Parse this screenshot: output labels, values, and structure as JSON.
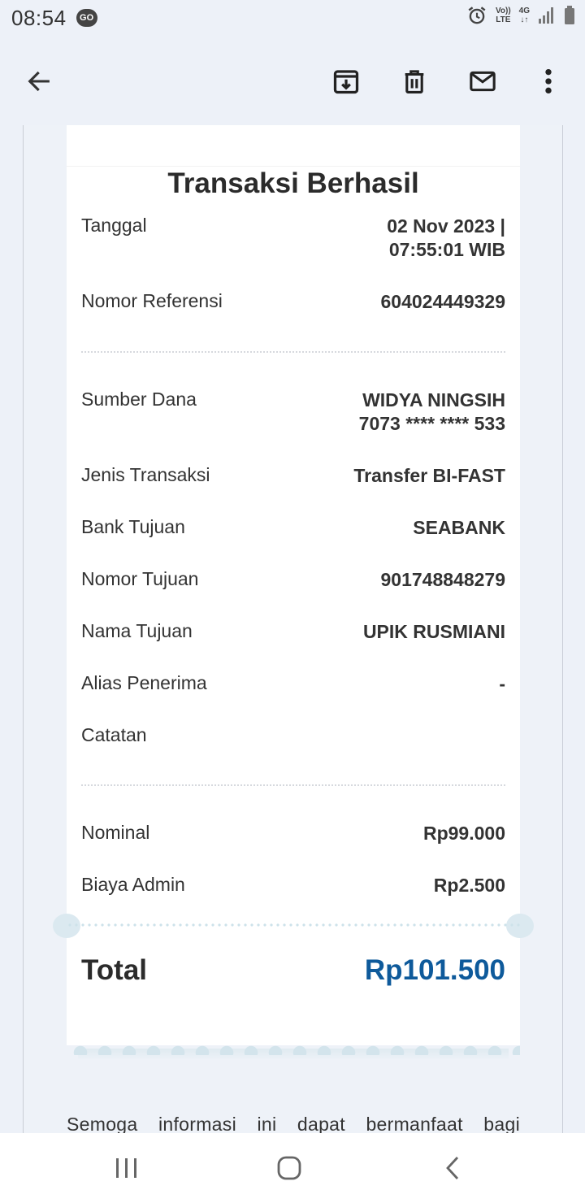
{
  "status_bar": {
    "time": "08:54",
    "app_badge": "GO",
    "volte_top": "Vo))",
    "volte_bottom": "LTE",
    "network_top": "4G",
    "network_bottom": "↓↑"
  },
  "app_bar": {
    "icons": [
      "back-arrow-icon",
      "archive-icon",
      "delete-icon",
      "mail-icon",
      "more-vert-icon"
    ]
  },
  "receipt": {
    "title": "Transaksi Berhasil",
    "rows_top": [
      {
        "label": "Tanggal",
        "value_line1": "02 Nov 2023 |",
        "value_line2": "07:55:01 WIB"
      },
      {
        "label": "Nomor Referensi",
        "value": "604024449329"
      }
    ],
    "source": {
      "label": "Sumber Dana",
      "value_line1": "WIDYA NINGSIH",
      "value_line2": "7073 **** **** 533"
    },
    "rows_mid": [
      {
        "label": "Jenis Transaksi",
        "value": "Transfer BI-FAST"
      },
      {
        "label": "Bank Tujuan",
        "value": "SEABANK"
      },
      {
        "label": "Nomor Tujuan",
        "value": "901748848279"
      },
      {
        "label": "Nama Tujuan",
        "value": "UPIK RUSMIANI"
      },
      {
        "label": "Alias Penerima",
        "value": "-"
      },
      {
        "label": "Catatan",
        "value": ""
      }
    ],
    "rows_bottom": [
      {
        "label": "Nominal",
        "value": "Rp99.000"
      },
      {
        "label": "Biaya Admin",
        "value": "Rp2.500"
      }
    ],
    "total": {
      "label": "Total",
      "value": "Rp101.500"
    }
  },
  "footer_text": "Semoga informasi ini dapat bermanfaat bagi",
  "colors": {
    "accent_total": "#0e5a9b",
    "background": "#edf1f8"
  }
}
